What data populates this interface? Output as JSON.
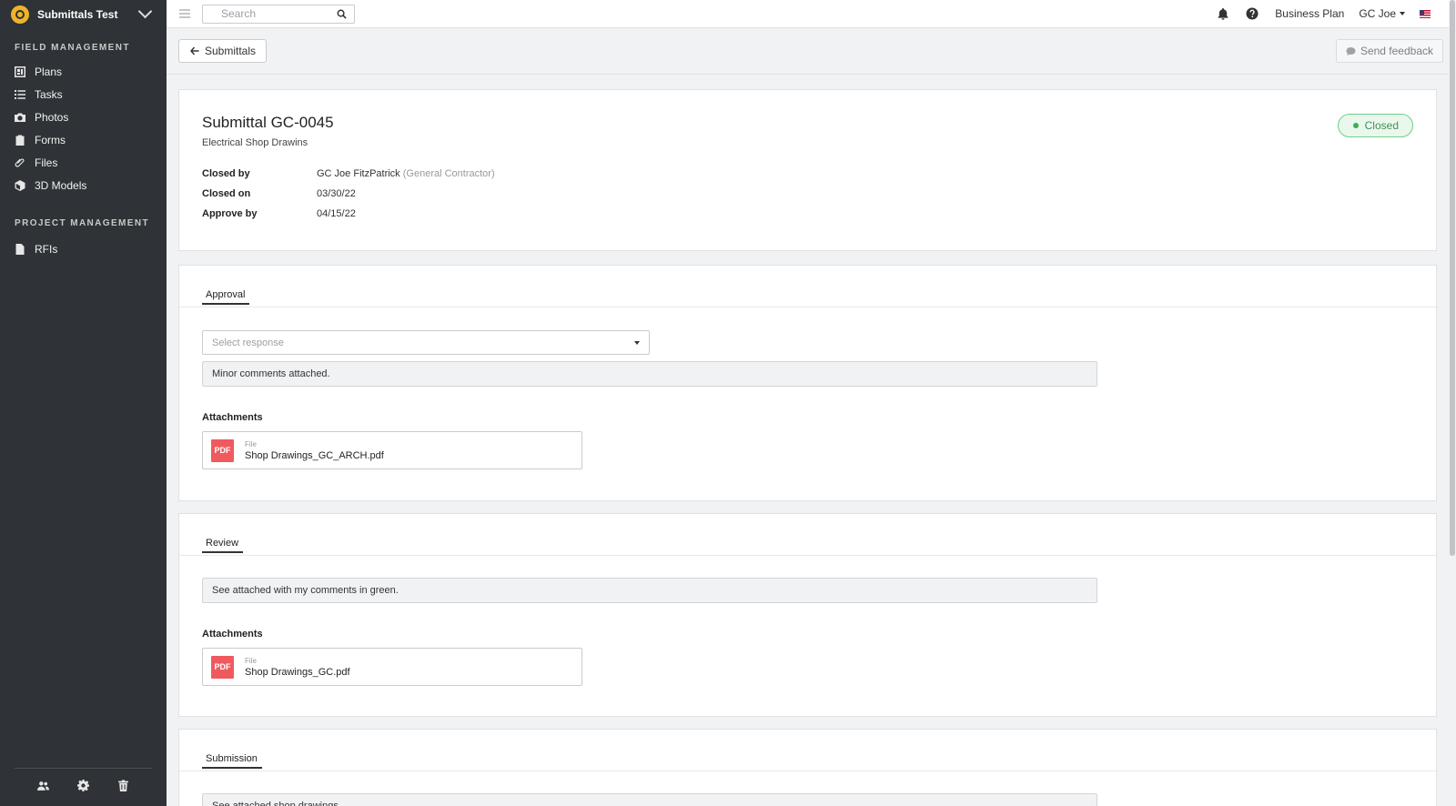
{
  "sidebar": {
    "project_name": "Submittals Test",
    "sections": [
      {
        "label": "FIELD MANAGEMENT",
        "items": [
          "Plans",
          "Tasks",
          "Photos",
          "Forms",
          "Files",
          "3D Models"
        ]
      },
      {
        "label": "PROJECT MANAGEMENT",
        "items": [
          "RFIs"
        ]
      }
    ],
    "bottom_icons": [
      "users-icon",
      "gear-icon",
      "trash-icon"
    ]
  },
  "topbar": {
    "search_placeholder": "Search",
    "plan": "Business Plan",
    "user": "GC Joe"
  },
  "subheader": {
    "back_label": "Submittals",
    "feedback_label": "Send feedback"
  },
  "submittal": {
    "title": "Submittal GC-0045",
    "subtitle": "Electrical Shop Drawins",
    "status": "Closed",
    "status_color": "#38b04f",
    "meta": {
      "closed_by_label": "Closed by",
      "closed_by_name": "GC Joe FitzPatrick",
      "closed_by_role": "(General Contractor)",
      "closed_on_label": "Closed on",
      "closed_on": "03/30/22",
      "approve_by_label": "Approve by",
      "approve_by": "04/15/22"
    }
  },
  "approval": {
    "tab": "Approval",
    "select_placeholder": "Select response",
    "comment": "Minor comments attached.",
    "attachments_label": "Attachments",
    "file_kind": "File",
    "file_name": "Shop Drawings_GC_ARCH.pdf"
  },
  "review": {
    "tab": "Review",
    "comment": "See attached with my comments in green.",
    "attachments_label": "Attachments",
    "file_kind": "File",
    "file_name": "Shop Drawings_GC.pdf"
  },
  "submission": {
    "tab": "Submission",
    "comment": "See attached shop drawings."
  },
  "pdf_badge": "PDF"
}
